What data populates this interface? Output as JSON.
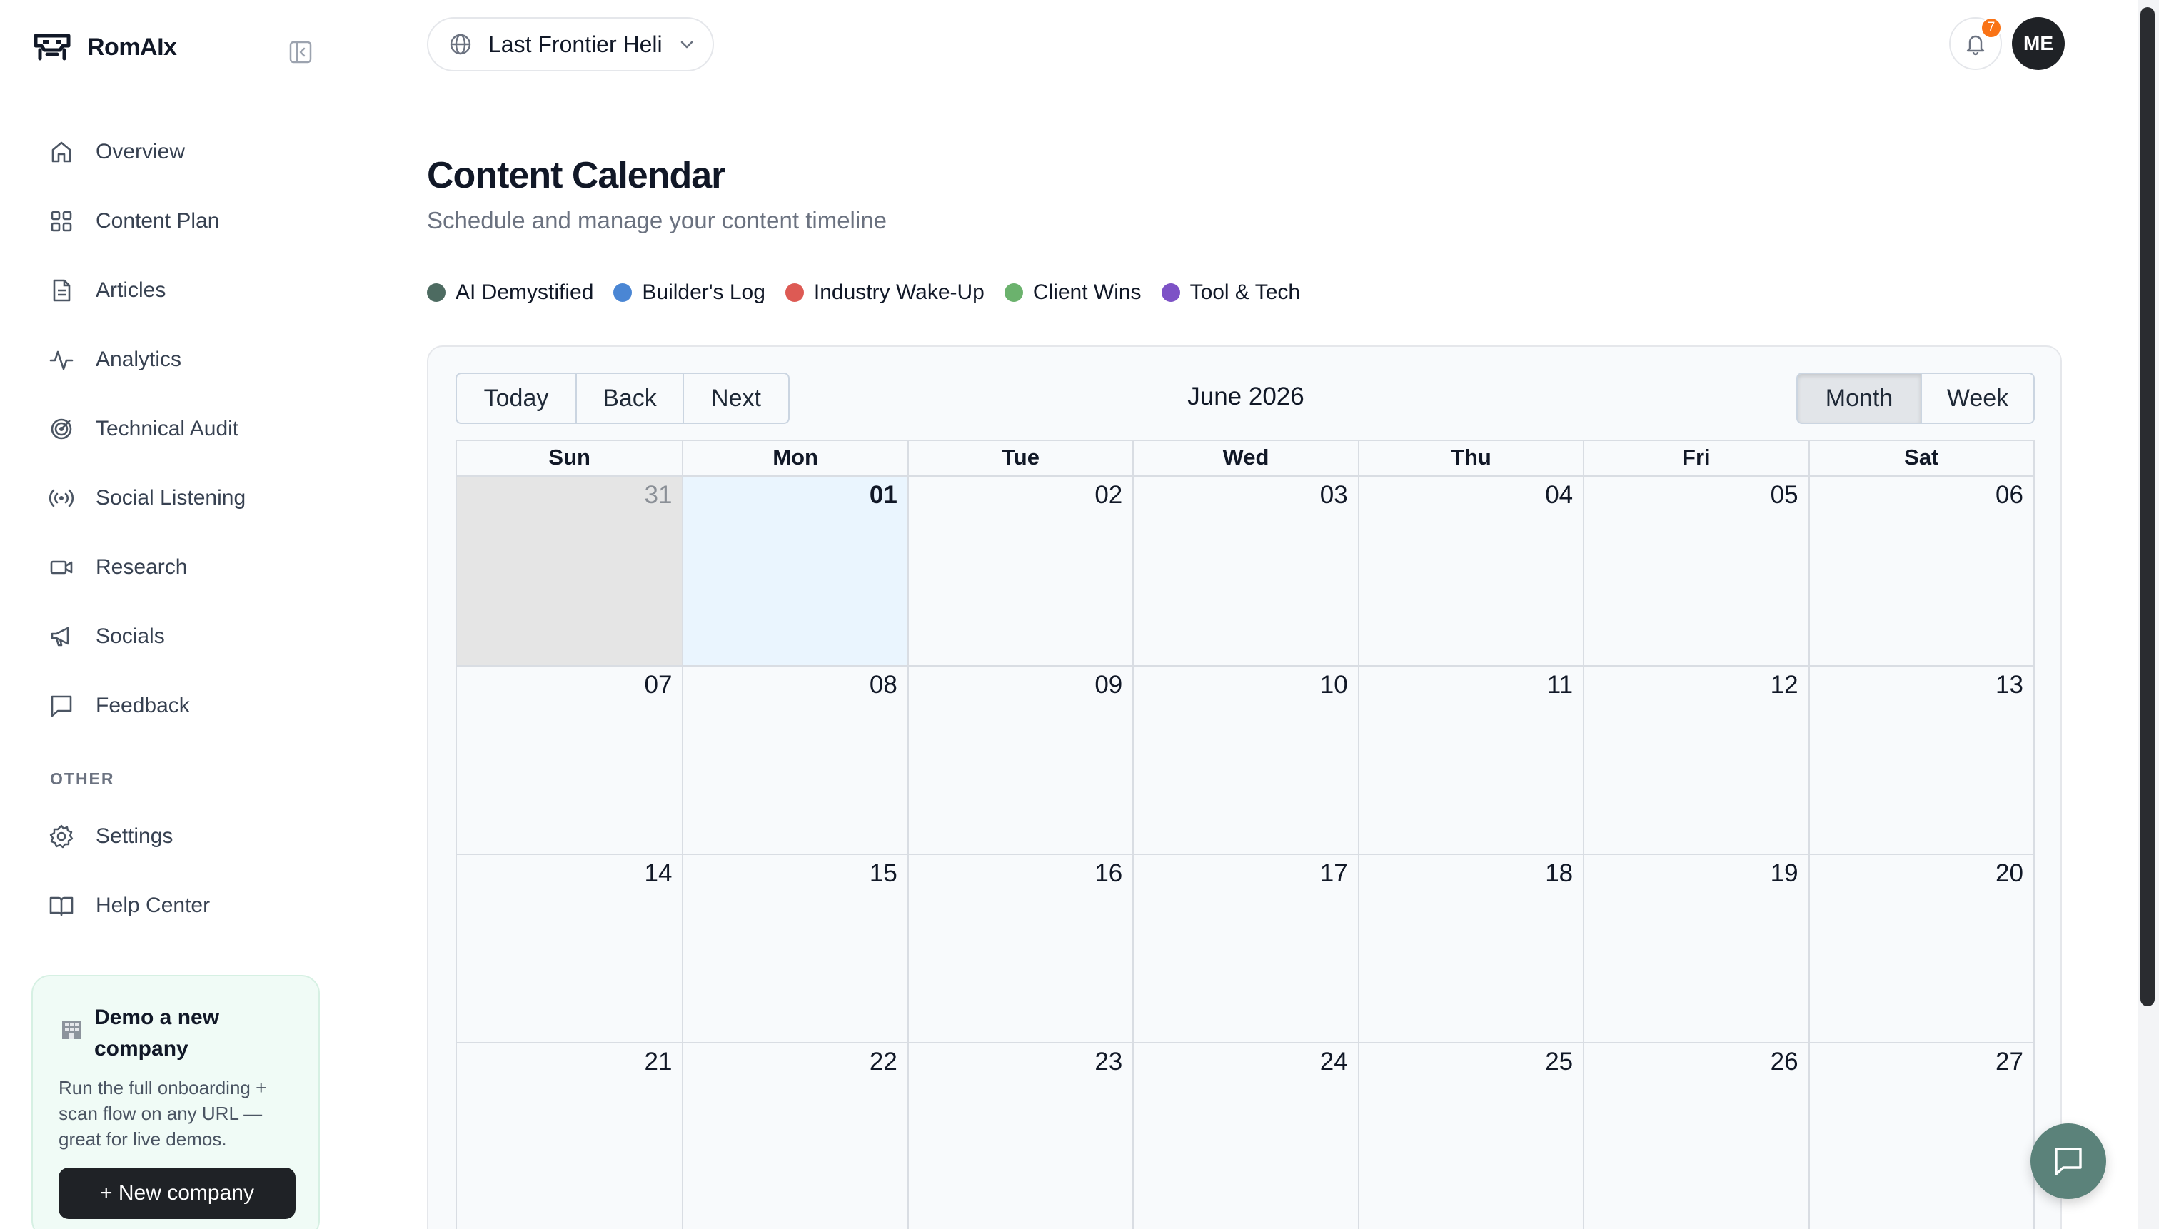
{
  "brand": {
    "name": "RomAIx"
  },
  "nav": {
    "items": [
      {
        "label": "Overview",
        "icon": "home-icon"
      },
      {
        "label": "Content Plan",
        "icon": "grid-icon"
      },
      {
        "label": "Articles",
        "icon": "document-icon"
      },
      {
        "label": "Analytics",
        "icon": "activity-icon"
      },
      {
        "label": "Technical Audit",
        "icon": "target-icon"
      },
      {
        "label": "Social Listening",
        "icon": "broadcast-icon"
      },
      {
        "label": "Research",
        "icon": "video-icon"
      },
      {
        "label": "Socials",
        "icon": "megaphone-icon"
      },
      {
        "label": "Feedback",
        "icon": "message-icon"
      }
    ],
    "other_label": "OTHER",
    "other_items": [
      {
        "label": "Settings",
        "icon": "gear-icon"
      },
      {
        "label": "Help Center",
        "icon": "book-icon"
      }
    ]
  },
  "demo": {
    "title": "Demo a new company",
    "description": "Run the full onboarding + scan flow on any URL — great for live demos.",
    "button": "+ New company"
  },
  "topbar": {
    "company": "Last Frontier Heli",
    "notifications": "7",
    "avatar": "ME"
  },
  "page": {
    "title": "Content Calendar",
    "subtitle": "Schedule and manage your content timeline"
  },
  "legend": [
    {
      "label": "AI Demystified",
      "color": "#4d6b61"
    },
    {
      "label": "Builder's Log",
      "color": "#4a86d4"
    },
    {
      "label": "Industry Wake-Up",
      "color": "#dd5a54"
    },
    {
      "label": "Client Wins",
      "color": "#6bb26d"
    },
    {
      "label": "Tool & Tech",
      "color": "#7d52c6"
    }
  ],
  "calendar": {
    "nav_buttons": {
      "today": "Today",
      "back": "Back",
      "next": "Next"
    },
    "month_label": "June 2026",
    "views": {
      "month": "Month",
      "week": "Week",
      "active": "month"
    },
    "weekdays": [
      "Sun",
      "Mon",
      "Tue",
      "Wed",
      "Thu",
      "Fri",
      "Sat"
    ],
    "weeks": [
      [
        "31",
        "01",
        "02",
        "03",
        "04",
        "05",
        "06"
      ],
      [
        "07",
        "08",
        "09",
        "10",
        "11",
        "12",
        "13"
      ],
      [
        "14",
        "15",
        "16",
        "17",
        "18",
        "19",
        "20"
      ],
      [
        "21",
        "22",
        "23",
        "24",
        "25",
        "26",
        "27"
      ]
    ],
    "off_range_days": [
      "31"
    ],
    "today": "01"
  }
}
